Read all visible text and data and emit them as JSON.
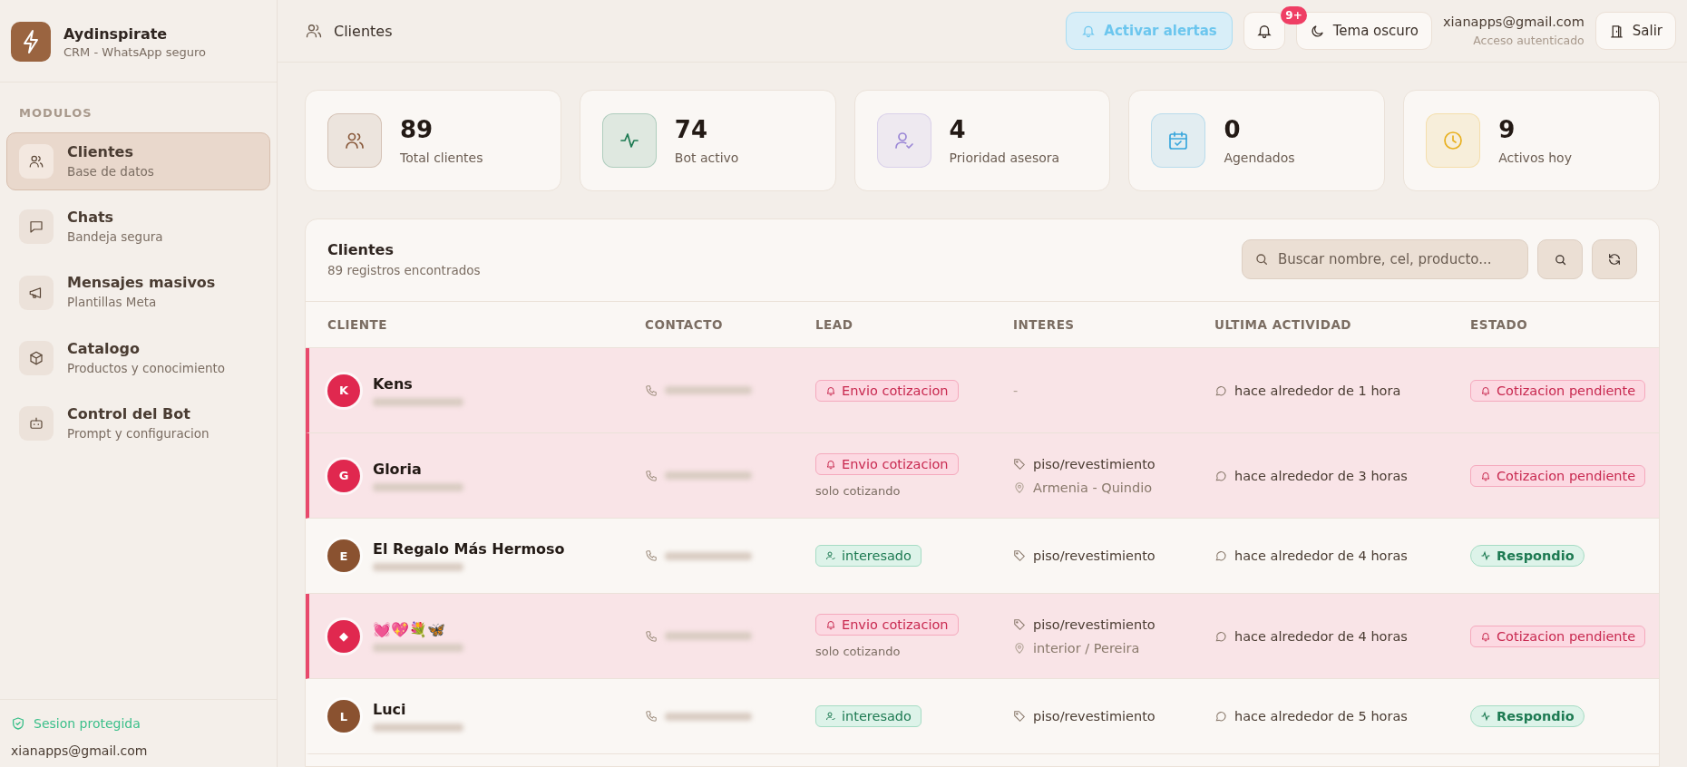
{
  "brand": {
    "name": "Aydinspirate",
    "subtitle": "CRM - WhatsApp seguro"
  },
  "sidebar": {
    "section": "MODULOS",
    "items": [
      {
        "label": "Clientes",
        "sub": "Base de datos",
        "kind": "users",
        "selected": true
      },
      {
        "label": "Chats",
        "sub": "Bandeja segura",
        "kind": "chat",
        "selected": false
      },
      {
        "label": "Mensajes masivos",
        "sub": "Plantillas Meta",
        "kind": "megaphone",
        "selected": false
      },
      {
        "label": "Catalogo",
        "sub": "Productos y conocimiento",
        "kind": "box",
        "selected": false
      },
      {
        "label": "Control del Bot",
        "sub": "Prompt y configuracion",
        "kind": "bot",
        "selected": false
      }
    ],
    "footer": {
      "status": "Sesion protegida",
      "email": "xianapps@gmail.com"
    }
  },
  "topbar": {
    "title": "Clientes",
    "alerts_button": "Activar alertas",
    "notification_badge": "9+",
    "theme_button": "Tema oscuro",
    "user_email": "xianapps@gmail.com",
    "user_status": "Acceso autenticado",
    "logout_button": "Salir"
  },
  "stats": [
    {
      "value": "89",
      "label": "Total clientes",
      "kind": "users",
      "color": "#8a5a3c"
    },
    {
      "value": "74",
      "label": "Bot activo",
      "kind": "pulse",
      "color": "#1d7a52"
    },
    {
      "value": "4",
      "label": "Prioridad asesora",
      "kind": "user-check",
      "color": "#9b87d6"
    },
    {
      "value": "0",
      "label": "Agendados",
      "kind": "calendar",
      "color": "#3aa6dc"
    },
    {
      "value": "9",
      "label": "Activos hoy",
      "kind": "clock",
      "color": "#e8b020"
    }
  ],
  "table": {
    "title": "Clientes",
    "count": "89 registros encontrados",
    "search": {
      "placeholder": "Buscar nombre, cel, producto..."
    },
    "columns": [
      "CLIENTE",
      "CONTACTO",
      "LEAD",
      "INTERES",
      "ULTIMA ACTIVIDAD",
      "ESTADO"
    ],
    "rows": [
      {
        "name": "Kens",
        "avatar": "K",
        "color": "#e0284f",
        "highlighted": true,
        "lead": {
          "kind": "quote",
          "label": "Envio cotizacion"
        },
        "interest": [
          {
            "kind": "empty",
            "text": "-"
          }
        ],
        "activity": "hace alrededor de 1 hora",
        "status": {
          "kind": "pending",
          "label": "Cotizacion pendiente"
        }
      },
      {
        "name": "Gloria",
        "avatar": "G",
        "color": "#e0284f",
        "highlighted": true,
        "lead": {
          "kind": "quote",
          "label": "Envio cotizacion",
          "note": "solo cotizando"
        },
        "interest": [
          {
            "kind": "tag",
            "text": "piso/revestimiento"
          },
          {
            "kind": "location",
            "text": "Armenia - Quindio"
          }
        ],
        "activity": "hace alrededor de 3 horas",
        "status": {
          "kind": "pending",
          "label": "Cotizacion pendiente"
        }
      },
      {
        "name": "El Regalo Más Hermoso",
        "avatar": "E",
        "color": "#8a5230",
        "highlighted": false,
        "lead": {
          "kind": "interested",
          "label": "interesado"
        },
        "interest": [
          {
            "kind": "tag",
            "text": "piso/revestimiento"
          }
        ],
        "activity": "hace alrededor de 4 horas",
        "status": {
          "kind": "replied",
          "label": "Respondio"
        }
      },
      {
        "name": "💓💖💐🦋",
        "avatar": "◆",
        "color": "#e0284f",
        "highlighted": true,
        "lead": {
          "kind": "quote",
          "label": "Envio cotizacion",
          "note": "solo cotizando"
        },
        "interest": [
          {
            "kind": "tag",
            "text": "piso/revestimiento"
          },
          {
            "kind": "location",
            "text": "interior / Pereira"
          }
        ],
        "activity": "hace alrededor de 4 horas",
        "status": {
          "kind": "pending",
          "label": "Cotizacion pendiente"
        }
      },
      {
        "name": "Luci",
        "avatar": "L",
        "color": "#8a5230",
        "highlighted": false,
        "lead": {
          "kind": "interested",
          "label": "interesado"
        },
        "interest": [
          {
            "kind": "tag",
            "text": "piso/revestimiento"
          }
        ],
        "activity": "hace alrededor de 5 horas",
        "status": {
          "kind": "replied",
          "label": "Respondio"
        }
      }
    ]
  }
}
